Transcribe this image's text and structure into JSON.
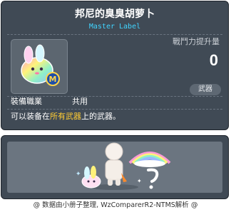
{
  "item_id": "01703253",
  "item": {
    "name": "邦尼的臭臭胡萝卜",
    "label": "Master Label",
    "power_label": "戰鬥力提升量",
    "power_value": "0",
    "category": "武器",
    "job_label": "裝備職業",
    "job_value": "共用",
    "description_prefix": "可以装备在",
    "description_highlight": "所有武器",
    "description_suffix": "上的武器。"
  },
  "footer": {
    "text": "@ 数据由小册子整理, WzComparerR2-NTMS解析 @"
  },
  "colors": {
    "panel_bg": "#404a55",
    "title": "#ffffff",
    "label_cyan": "#40d4ff",
    "highlight": "#ffcc33"
  }
}
